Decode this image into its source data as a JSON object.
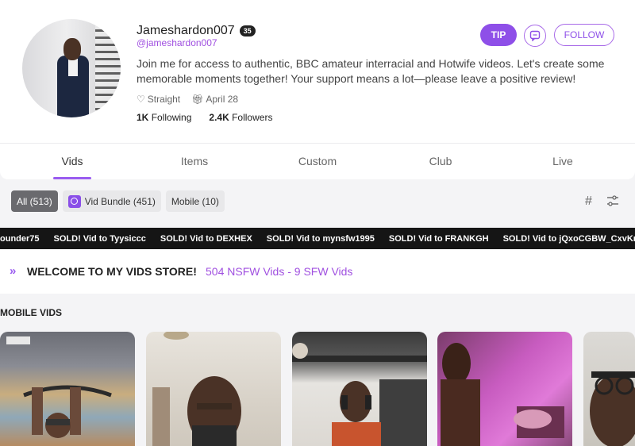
{
  "profile": {
    "name": "Jameshardon007",
    "age": "35",
    "handle": "@jameshardon007",
    "bio": "Join me for access to authentic, BBC amateur interracial and Hotwife videos. Let's create some memorable moments together! Your support means a lot—please leave a positive review!",
    "orientation": "Straight",
    "joined": "April 28",
    "following_count": "1K",
    "following_label": "Following",
    "followers_count": "2.4K",
    "followers_label": "Followers"
  },
  "actions": {
    "tip_label": "TIP",
    "follow_label": "FOLLOW",
    "message_icon": "message-icon"
  },
  "tabs": [
    {
      "label": "Vids",
      "active": true
    },
    {
      "label": "Items"
    },
    {
      "label": "Custom"
    },
    {
      "label": "Club"
    },
    {
      "label": "Live"
    }
  ],
  "filters": [
    {
      "label": "All (513)",
      "active": true
    },
    {
      "label": "Vid Bundle (451)",
      "icon": "bundle-icon"
    },
    {
      "label": "Mobile (10)"
    }
  ],
  "ticker": [
    "ounder75",
    "SOLD! Vid to Tyysiccc",
    "SOLD! Vid to DEXHEX",
    "SOLD! Vid to mynsfw1995",
    "SOLD! Vid to FRANKGH",
    "SOLD! Vid to jQxoCGBW_CxvKrA"
  ],
  "welcome": {
    "title": "WELCOME TO MY VIDS STORE!",
    "counts": "504 NSFW Vids  -  9 SFW Vids"
  },
  "section": {
    "mobile_label": "MOBILE VIDS"
  },
  "colors": {
    "accent": "#8e4fe8",
    "ticker_bg": "#151515"
  }
}
